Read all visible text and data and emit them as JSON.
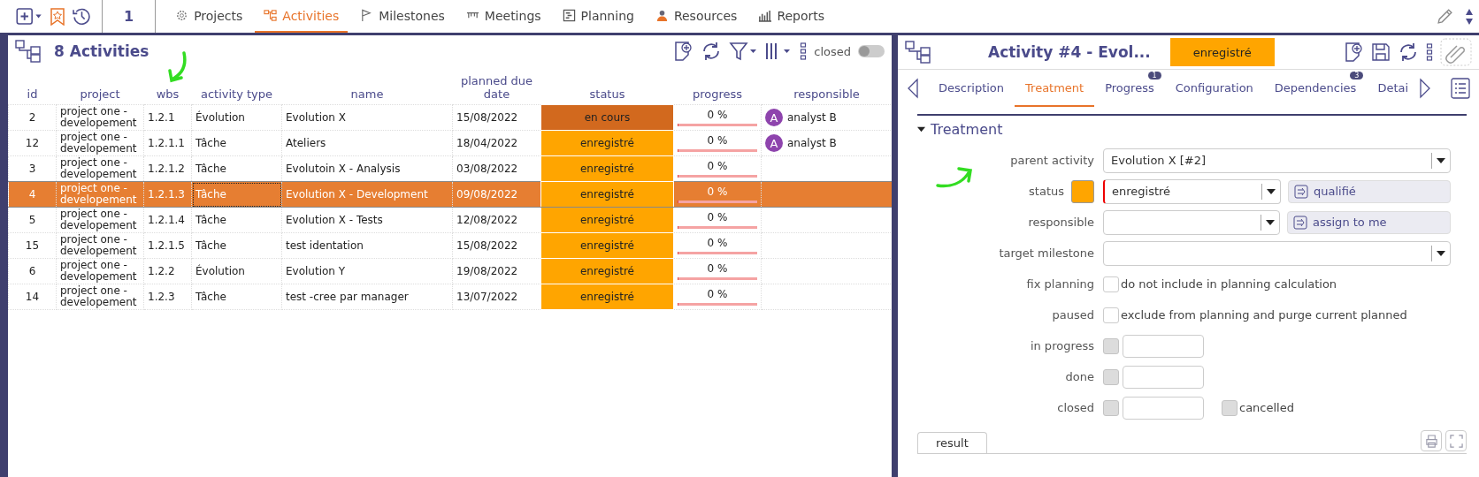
{
  "toolbar": {
    "counter": "1",
    "menu": [
      {
        "label": "Projects",
        "selected": false
      },
      {
        "label": "Activities",
        "selected": true
      },
      {
        "label": "Milestones",
        "selected": false
      },
      {
        "label": "Meetings",
        "selected": false
      },
      {
        "label": "Planning",
        "selected": false
      },
      {
        "label": "Resources",
        "selected": false
      },
      {
        "label": "Reports",
        "selected": false
      }
    ]
  },
  "list": {
    "title": "8 Activities",
    "closed_label": "closed",
    "closed_on": false,
    "columns": [
      "id",
      "project",
      "wbs",
      "activity type",
      "name",
      "planned due date",
      "status",
      "progress",
      "responsible"
    ],
    "rows": [
      {
        "id": "2",
        "project": "project one - developement",
        "wbs": "1.2.1",
        "type": "Évolution",
        "name": "Evolution X",
        "due_date": "15/08/2022",
        "status": "en cours",
        "color": "#d2691e",
        "progress": "0 %",
        "level": 0,
        "avatar": "A",
        "responsible": "analyst B",
        "selected": false
      },
      {
        "id": "12",
        "project": "project one - developement",
        "wbs": "1.2.1.1",
        "type": "Tâche",
        "name": "Ateliers",
        "due_date": "18/04/2022",
        "status": "enregistré",
        "color": "#ffa500",
        "progress": "0 %",
        "level": 0,
        "avatar": "A",
        "responsible": "analyst B",
        "selected": false
      },
      {
        "id": "3",
        "project": "project one - developement",
        "wbs": "1.2.1.2",
        "type": "Tâche",
        "name": "Evolutoin X - Analysis",
        "due_date": "03/08/2022",
        "status": "enregistré",
        "color": "#ffa500",
        "progress": "0 %",
        "level": 0,
        "selected": false
      },
      {
        "id": "4",
        "project": "project one - developement",
        "wbs": "1.2.1.3",
        "type": "Tâche",
        "name": "Evolution X - Development",
        "due_date": "09/08/2022",
        "status": "enregistré",
        "color": "#ffa500",
        "progress": "0 %",
        "level": 0,
        "selected": true
      },
      {
        "id": "5",
        "project": "project one - developement",
        "wbs": "1.2.1.4",
        "type": "Tâche",
        "name": "Evolution X - Tests",
        "due_date": "12/08/2022",
        "status": "enregistré",
        "color": "#ffa500",
        "progress": "0 %",
        "level": 0,
        "selected": false
      },
      {
        "id": "15",
        "project": "project one - developement",
        "wbs": "1.2.1.5",
        "type": "Tâche",
        "name": "test identation",
        "due_date": "15/08/2022",
        "status": "enregistré",
        "color": "#ffa500",
        "progress": "0 %",
        "level": 0,
        "selected": false
      },
      {
        "id": "6",
        "project": "project one - developement",
        "wbs": "1.2.2",
        "type": "Évolution",
        "name": "Evolution Y",
        "due_date": "19/08/2022",
        "status": "enregistré",
        "color": "#ffa500",
        "progress": "0 %",
        "level": 0,
        "selected": false
      },
      {
        "id": "14",
        "project": "project one - developement",
        "wbs": "1.2.3",
        "type": "Tâche",
        "name": "test -cree par manager",
        "due_date": "13/07/2022",
        "status": "enregistré",
        "color": "#ffa500",
        "progress": "0 %",
        "level": 0,
        "selected": false
      }
    ]
  },
  "detail": {
    "title": "Activity  #4  - Evol...",
    "status": "enregistré",
    "color": "#ffa500",
    "tabs": [
      {
        "label": "Description",
        "selected": false
      },
      {
        "label": "Treatment",
        "selected": true
      },
      {
        "label": "Progress",
        "badge": "1",
        "selected": false
      },
      {
        "label": "Configuration",
        "selected": false
      },
      {
        "label": "Dependencies",
        "badge": "3",
        "selected": false
      },
      {
        "label": "Detai",
        "selected": false
      }
    ],
    "section": {
      "title": "Treatment",
      "expanded": true
    },
    "fields": [
      {
        "kind": "select",
        "label": "parent activity",
        "value": "Evolution X [#2]"
      },
      {
        "kind": "status",
        "label": "status",
        "color": "#ffa500",
        "value": "enregistré",
        "button": "qualifié"
      },
      {
        "kind": "select_button",
        "label": "responsible",
        "button": "assign to me"
      },
      {
        "kind": "select",
        "label": "target milestone"
      },
      {
        "kind": "check",
        "label": "fix planning",
        "text": "do not include in planning calculation",
        "checked": false,
        "disabled": false
      },
      {
        "kind": "check",
        "label": "paused",
        "text": "exclude from planning and purge current planned",
        "checked": false,
        "disabled": false
      },
      {
        "kind": "date",
        "label": "in progress",
        "checked": false,
        "disabled": true
      },
      {
        "kind": "date",
        "label": "done",
        "checked": false,
        "disabled": true
      },
      {
        "kind": "date",
        "label": "closed",
        "checked": false,
        "disabled": true,
        "extra": {
          "label": "cancelled",
          "checked": false,
          "disabled": true
        }
      }
    ],
    "result_tab": "result"
  }
}
